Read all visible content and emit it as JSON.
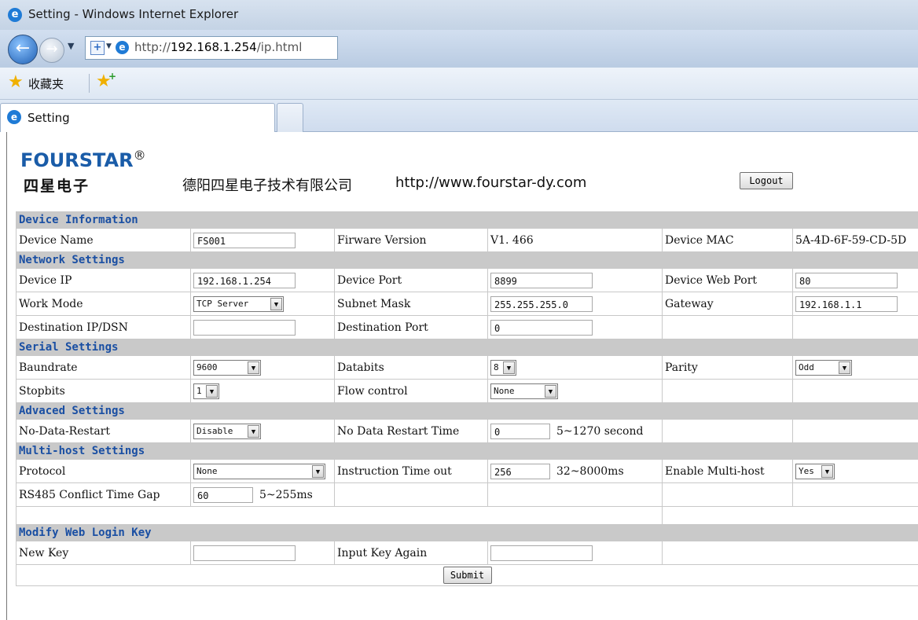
{
  "window": {
    "title": "Setting - Windows Internet Explorer"
  },
  "browser": {
    "url_prefix": "http://",
    "url_host": "192.168.1.254",
    "url_path": "/ip.html",
    "favorites_label": "收藏夹",
    "tab_title": "Setting"
  },
  "header": {
    "logo_text": "FOURSTAR",
    "logo_reg": "®",
    "logo_cn": "四星电子",
    "company_name": "德阳四星电子技术有限公司",
    "website": "http://www.fourstar-dy.com",
    "logout_label": "Logout"
  },
  "sections": {
    "device_info": "Device Information",
    "network": "Network Settings",
    "serial": "Serial Settings",
    "advanced": "Advaced Settings",
    "multihost": "Multi-host Settings",
    "login_key": "Modify Web Login Key"
  },
  "device_info": {
    "name_label": "Device Name",
    "name_value": "FS001",
    "fw_label": "Firware Version",
    "fw_value": "V1. 466",
    "mac_label": "Device MAC",
    "mac_value": "5A-4D-6F-59-CD-5D"
  },
  "network": {
    "ip_label": "Device IP",
    "ip_value": "192.168.1.254",
    "port_label": "Device Port",
    "port_value": "8899",
    "webport_label": "Device Web Port",
    "webport_value": "80",
    "mode_label": "Work Mode",
    "mode_value": "TCP Server",
    "mask_label": "Subnet Mask",
    "mask_value": "255.255.255.0",
    "gw_label": "Gateway",
    "gw_value": "192.168.1.1",
    "dest_ip_label": "Destination IP/DSN",
    "dest_ip_value": "",
    "dest_port_label": "Destination Port",
    "dest_port_value": "0"
  },
  "serial": {
    "baud_label": "Baundrate",
    "baud_value": "9600",
    "databits_label": "Databits",
    "databits_value": "8",
    "parity_label": "Parity",
    "parity_value": "Odd",
    "stopbits_label": "Stopbits",
    "stopbits_value": "1",
    "flow_label": "Flow control",
    "flow_value": "None"
  },
  "advanced": {
    "restart_label": "No-Data-Restart",
    "restart_value": "Disable",
    "restart_time_label": "No Data Restart Time",
    "restart_time_value": "0",
    "restart_time_hint": "5~1270 second"
  },
  "multihost": {
    "protocol_label": "Protocol",
    "protocol_value": "None",
    "timeout_label": "Instruction Time out",
    "timeout_value": "256",
    "timeout_hint": "32~8000ms",
    "enable_label": "Enable Multi-host",
    "enable_value": "Yes",
    "gap_label": "RS485 Conflict Time Gap",
    "gap_value": "60",
    "gap_hint": "5~255ms"
  },
  "login_key": {
    "new_label": "New Key",
    "new_value": "",
    "again_label": "Input Key Again",
    "again_value": "",
    "submit_label": "Submit"
  },
  "colors": {
    "section_text": "#1a4fa3",
    "section_bg": "#c9c9c9",
    "logo_blue": "#1a5ca8"
  },
  "icons": [
    "ie-icon",
    "back-icon",
    "forward-icon",
    "page-icon",
    "favorites-star-icon",
    "add-favorite-icon"
  ]
}
